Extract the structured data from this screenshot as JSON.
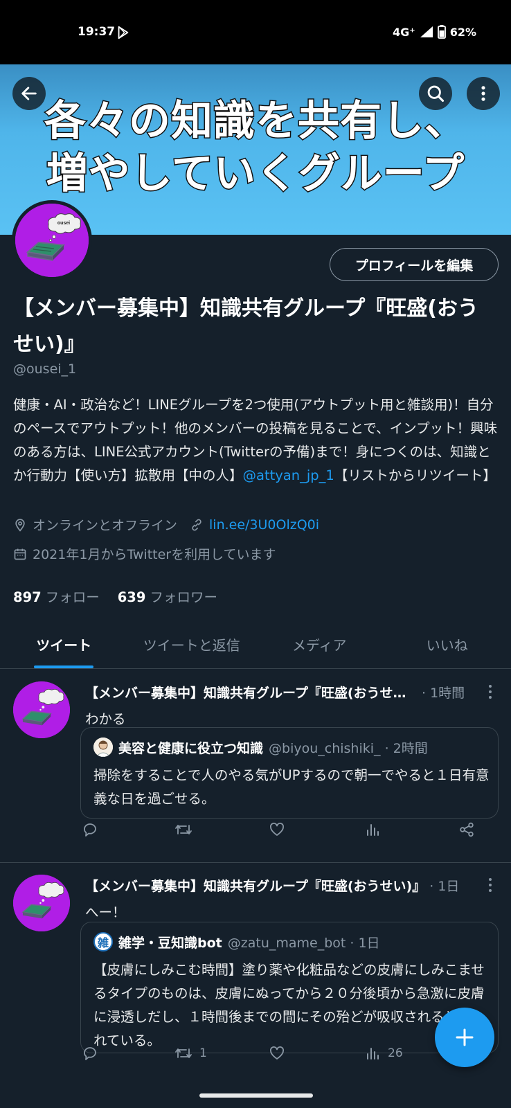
{
  "status_bar": {
    "time": "19:37",
    "network": "4G⁺",
    "battery": "62%"
  },
  "banner": {
    "line1": "各々の知識を共有し、",
    "line2": "増やしていくグループ"
  },
  "profile": {
    "edit_button": "プロフィールを編集",
    "display_name": "【メンバー募集中】知識共有グループ『旺盛(おうせい)』",
    "handle": "@ousei_1",
    "bio_text": "健康・AI・政治など！LINEグループを2つ使用(アウトプット用と雑談用)！自分のペースでアウトプット！他のメンバーの投稿を見ることで、インプット！興味のある方は、LINE公式アカウント(Twitterの予備)まで！身につくのは、知識とか行動力【使い方】拡散用【中の人】",
    "bio_mention": "@attyan_jp_1",
    "bio_tail": "【リストからリツイート】",
    "location": "オンラインとオフライン",
    "link": "lin.ee/3U0OlzQ0i",
    "joined": "2021年1月からTwitterを利用しています",
    "following_count": "897",
    "following_label": "フォロー",
    "followers_count": "639",
    "followers_label": "フォロワー",
    "avatar_label": "ousei"
  },
  "tabs": [
    {
      "label": "ツイート",
      "active": true
    },
    {
      "label": "ツイートと返信",
      "active": false
    },
    {
      "label": "メディア",
      "active": false
    },
    {
      "label": "いいね",
      "active": false
    }
  ],
  "tweets": [
    {
      "name": "【メンバー募集中】知識共有グループ『旺盛(おうせい)』",
      "time": "· 1時間",
      "text": "わかる",
      "quote": {
        "name": "美容と健康に役立つ知識",
        "meta": "@biyou_chishiki_ · 2時間",
        "text": "掃除をすることで人のやる気がUPするので朝一でやると１日有意義な日を過ごせる。"
      },
      "retweets": "",
      "views": ""
    },
    {
      "name": "【メンバー募集中】知識共有グループ『旺盛(おうせい)』",
      "time": "· 1日",
      "text": "へー！",
      "quote": {
        "avatar_char": "雑",
        "name": "雑学・豆知識bot",
        "meta": "@zatu_mame_bot · 1日",
        "text": "【皮膚にしみこむ時間】塗り薬や化粧品などの皮膚にしみこませるタイプのものは、皮膚にぬってから２０分後頃から急激に皮膚に浸透しだし、１時間後までの間にその殆どが吸収されるといわれている。"
      },
      "retweets": "1",
      "views": "26"
    }
  ],
  "colors": {
    "background": "#15202b",
    "accent": "#1d9bf0",
    "avatar": "#b01ee6",
    "banner": "#5ac2f4"
  }
}
